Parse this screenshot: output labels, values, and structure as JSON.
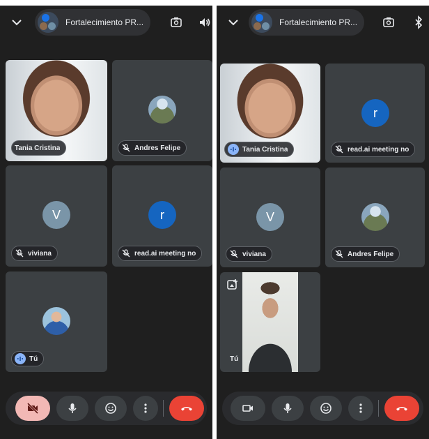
{
  "meeting_title": "Fortalecimiento PR...",
  "left": {
    "tiles": [
      {
        "name": "Tania Cristina"
      },
      {
        "name": "Andres Felipe"
      },
      {
        "name": "viviana",
        "initial": "V"
      },
      {
        "name": "read.ai meeting no",
        "initial": "r"
      },
      {
        "name": "Tú"
      }
    ]
  },
  "right": {
    "tiles": [
      {
        "name": "Tania Cristina"
      },
      {
        "name": "read.ai meeting no",
        "initial": "r"
      },
      {
        "name": "viviana",
        "initial": "V"
      },
      {
        "name": "Andres Felipe"
      },
      {
        "name": "Tú"
      }
    ]
  },
  "icons": {
    "collapse": "chevron-down-icon",
    "switch_camera": "flip-camera-icon",
    "speaker": "volume-icon",
    "bluetooth": "bluetooth-icon",
    "camera_off": "camera-off-icon",
    "camera": "video-camera-icon",
    "mic": "mic-icon",
    "reactions": "emoji-icon",
    "more": "more-vert-icon",
    "hangup": "hangup-icon",
    "muted": "mic-off-icon",
    "speaking": "speaking-icon"
  },
  "colors": {
    "background": "#1f1f1f",
    "tile": "#3c4043",
    "hangup": "#ea4335",
    "camera_off_bg": "#f2b8b5",
    "avatar_r": "#1565c0",
    "avatar_v": "#7a95a8"
  }
}
